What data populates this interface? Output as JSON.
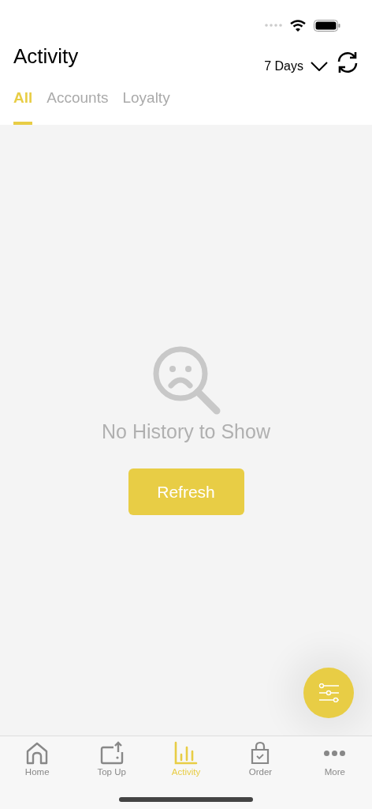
{
  "header": {
    "title": "Activity",
    "period": "7 Days"
  },
  "tabs": [
    {
      "label": "All",
      "selected": true
    },
    {
      "label": "Accounts",
      "selected": false
    },
    {
      "label": "Loyalty",
      "selected": false
    }
  ],
  "empty_state": {
    "message": "No History to Show",
    "button": "Refresh"
  },
  "nav": [
    {
      "kind": "home",
      "label": "Home",
      "selected": false
    },
    {
      "kind": "topup",
      "label": "Top Up",
      "selected": false
    },
    {
      "kind": "activity",
      "label": "Activity",
      "selected": true
    },
    {
      "kind": "order",
      "label": "Order",
      "selected": false
    },
    {
      "kind": "more",
      "label": "More",
      "selected": false
    }
  ]
}
